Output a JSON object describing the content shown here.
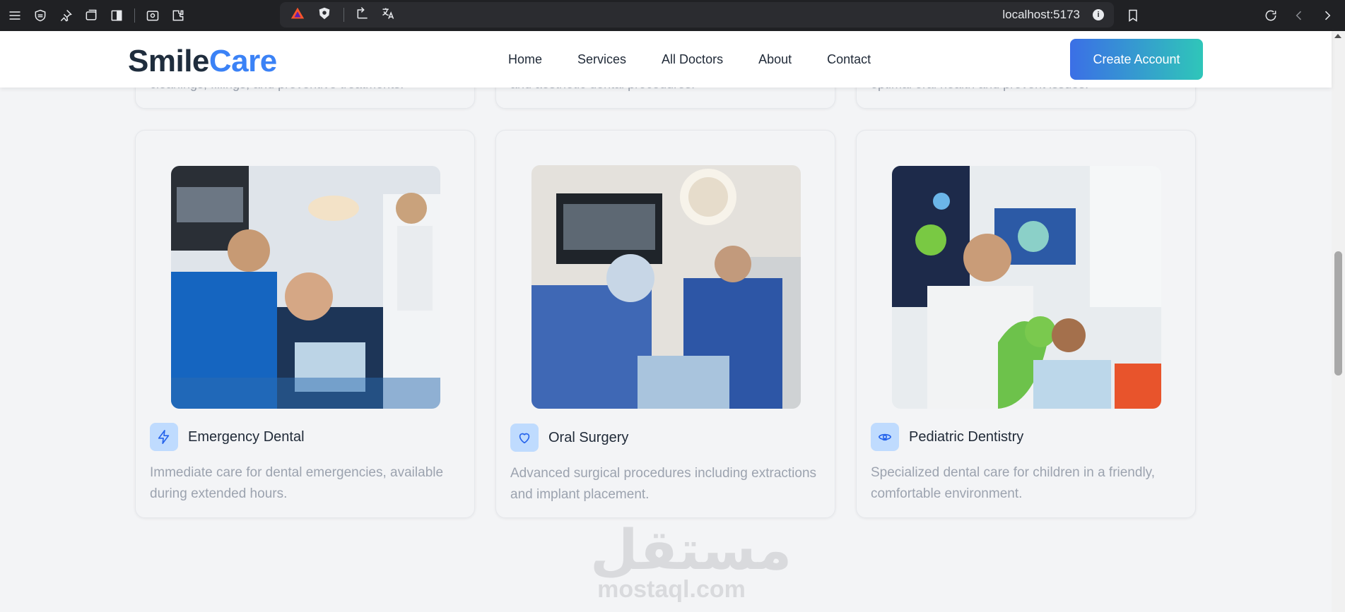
{
  "browser": {
    "url": "localhost:5173"
  },
  "header": {
    "logo_part1": "Smile",
    "logo_part2": "Care",
    "nav": [
      "Home",
      "Services",
      "All Doctors",
      "About",
      "Contact"
    ],
    "cta_label": "Create Account"
  },
  "colors": {
    "brand_dark": "#1f2d3d",
    "brand_blue": "#3b82f6",
    "gradient_start": "#3b6fe6",
    "gradient_end": "#2fc6b9",
    "icon_bg": "#bfdbfe"
  },
  "top_cards": [
    {
      "text": "cleanings, fillings, and preventive treatments."
    },
    {
      "text": "and aesthetic dental procedures."
    },
    {
      "text": "optimal oral health and prevent issues."
    }
  ],
  "services": [
    {
      "title": "Emergency Dental",
      "description": "Immediate care for dental emergencies, available during extended hours.",
      "icon": "lightning-icon"
    },
    {
      "title": "Oral Surgery",
      "description": "Advanced surgical procedures including extractions and implant placement.",
      "icon": "heart-icon"
    },
    {
      "title": "Pediatric Dentistry",
      "description": "Specialized dental care for children in a friendly, comfortable environment.",
      "icon": "smile-face-icon"
    }
  ],
  "watermark": {
    "arabic": "مستقل",
    "latin": "mostaql.com"
  }
}
